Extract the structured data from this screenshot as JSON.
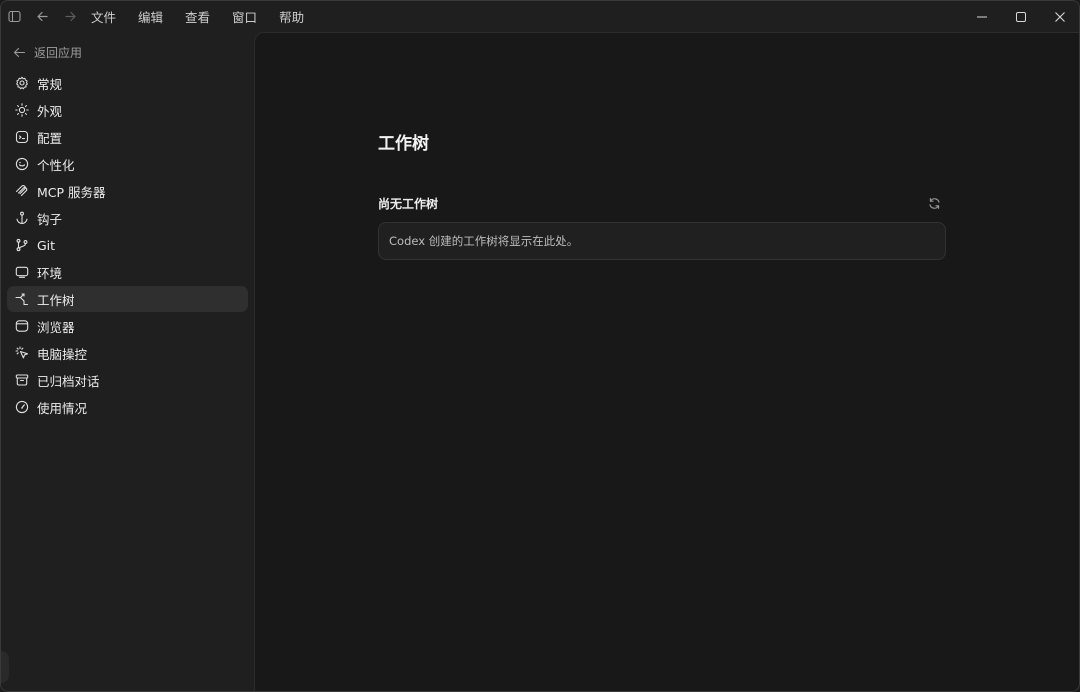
{
  "titlebar": {
    "menu": [
      "文件",
      "编辑",
      "查看",
      "窗口",
      "帮助"
    ]
  },
  "sidebar": {
    "back_label": "返回应用",
    "items": [
      {
        "label": "常规",
        "icon": "gear-icon"
      },
      {
        "label": "外观",
        "icon": "sun-icon"
      },
      {
        "label": "配置",
        "icon": "config-icon"
      },
      {
        "label": "个性化",
        "icon": "personalize-icon"
      },
      {
        "label": "MCP 服务器",
        "icon": "mcp-icon"
      },
      {
        "label": "钩子",
        "icon": "anchor-icon"
      },
      {
        "label": "Git",
        "icon": "git-branch-icon"
      },
      {
        "label": "环境",
        "icon": "monitor-icon"
      },
      {
        "label": "工作树",
        "icon": "worktree-icon",
        "active": true
      },
      {
        "label": "浏览器",
        "icon": "browser-icon"
      },
      {
        "label": "电脑操控",
        "icon": "computer-control-icon"
      },
      {
        "label": "已归档对话",
        "icon": "archive-icon"
      },
      {
        "label": "使用情况",
        "icon": "gauge-icon"
      }
    ]
  },
  "main": {
    "title": "工作树",
    "section_title": "尚无工作树",
    "empty_message": "Codex 创建的工作树将显示在此处。"
  },
  "colors": {
    "window_bg": "#1f1f1f",
    "main_bg": "#181818",
    "active_item_bg": "#2f2f2f",
    "card_bg": "#202020"
  }
}
